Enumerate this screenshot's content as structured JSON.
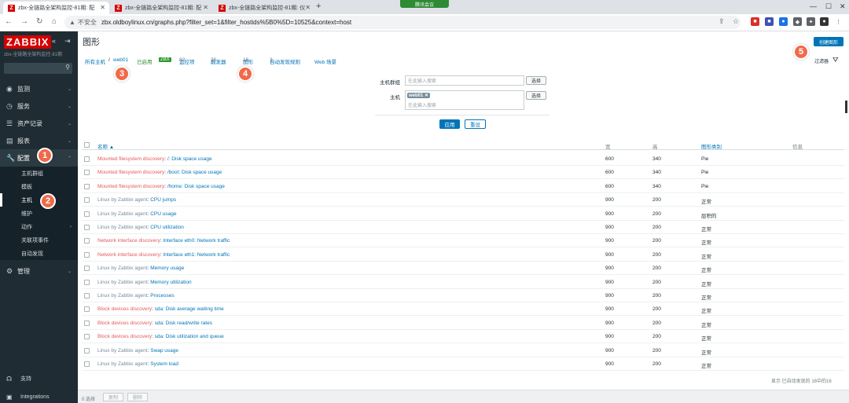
{
  "browser": {
    "tabs": [
      {
        "title": "zbx-全链路全架构监控-81期: 配",
        "active": true
      },
      {
        "title": "zbx-全链路全架构监控-81期: 配",
        "active": false
      },
      {
        "title": "zbx-全链路全架构监控-81期: 仪",
        "active": false
      }
    ],
    "meeting_label": "腾讯会议",
    "insecure_label": "不安全",
    "url": "zbx.oldboylinux.cn/graphs.php?filter_set=1&filter_hostids%5B0%5D=10525&context=host"
  },
  "sidebar": {
    "logo": "ZABBIX",
    "subtitle": "zbx-全链路全架构监控-81期",
    "menu": [
      {
        "label": "监测",
        "icon": "eye-icon"
      },
      {
        "label": "服务",
        "icon": "clock-icon"
      },
      {
        "label": "资产记录",
        "icon": "list-icon"
      },
      {
        "label": "报表",
        "icon": "chart-icon"
      },
      {
        "label": "配置",
        "icon": "wrench-icon"
      }
    ],
    "submenu": [
      "主机群组",
      "模板",
      "主机",
      "维护",
      "动作",
      "关联项事件",
      "自动发现"
    ],
    "admin_label": "管理",
    "support_label": "支持",
    "integrations_label": "Integrations"
  },
  "page": {
    "title": "图形",
    "create_button": "创建图形",
    "filter_label": "过滤器"
  },
  "hostnav": {
    "all_hosts": "所有主机",
    "sep": "/",
    "host": "web01",
    "enabled": "已启用",
    "zbx": "ZBX",
    "items_label": "监控项",
    "items_count": "82",
    "triggers_label": "触发器",
    "triggers_count": "36",
    "graphs_label": "图形",
    "graphs_count": "16",
    "discovery_label": "自动发现规则",
    "discovery_count": "3",
    "web_label": "Web 场景"
  },
  "filter": {
    "hostgroup_label": "主机群组",
    "hostgroup_placeholder": "在此输入搜索",
    "host_label": "主机",
    "host_tag": "web01",
    "host_placeholder": "在此输入搜索",
    "select_label": "选择",
    "apply_label": "应用",
    "reset_label": "重设"
  },
  "table": {
    "headers": {
      "name": "名称 ▲",
      "width": "宽",
      "height": "高",
      "graph_type": "图形类别",
      "info": "信息"
    },
    "rows": [
      {
        "prefix": "Mounted filesystem discovery",
        "prefix_style": "red",
        "name": "/: Disk space usage",
        "width": "600",
        "height": "340",
        "type": "Pie"
      },
      {
        "prefix": "Mounted filesystem discovery",
        "prefix_style": "red",
        "name": "/boot: Disk space usage",
        "width": "600",
        "height": "340",
        "type": "Pie"
      },
      {
        "prefix": "Mounted filesystem discovery",
        "prefix_style": "red",
        "name": "/home: Disk space usage",
        "width": "600",
        "height": "340",
        "type": "Pie"
      },
      {
        "prefix": "Linux by Zabbix agent",
        "prefix_style": "grey",
        "name": "CPU jumps",
        "width": "900",
        "height": "200",
        "type": "正常"
      },
      {
        "prefix": "Linux by Zabbix agent",
        "prefix_style": "grey",
        "name": "CPU usage",
        "width": "900",
        "height": "200",
        "type": "层积的"
      },
      {
        "prefix": "Linux by Zabbix agent",
        "prefix_style": "grey",
        "name": "CPU utilization",
        "width": "900",
        "height": "200",
        "type": "正常"
      },
      {
        "prefix": "Network interface discovery",
        "prefix_style": "red",
        "name": "Interface eth0: Network traffic",
        "width": "900",
        "height": "200",
        "type": "正常"
      },
      {
        "prefix": "Network interface discovery",
        "prefix_style": "red",
        "name": "Interface eth1: Network traffic",
        "width": "900",
        "height": "200",
        "type": "正常"
      },
      {
        "prefix": "Linux by Zabbix agent",
        "prefix_style": "grey",
        "name": "Memory usage",
        "width": "900",
        "height": "200",
        "type": "正常"
      },
      {
        "prefix": "Linux by Zabbix agent",
        "prefix_style": "grey",
        "name": "Memory utilization",
        "width": "900",
        "height": "200",
        "type": "正常"
      },
      {
        "prefix": "Linux by Zabbix agent",
        "prefix_style": "grey",
        "name": "Processes",
        "width": "900",
        "height": "200",
        "type": "正常"
      },
      {
        "prefix": "Block devices discovery",
        "prefix_style": "red",
        "name": "sda: Disk average waiting time",
        "width": "900",
        "height": "200",
        "type": "正常"
      },
      {
        "prefix": "Block devices discovery",
        "prefix_style": "red",
        "name": "sda: Disk read/write rates",
        "width": "900",
        "height": "200",
        "type": "正常"
      },
      {
        "prefix": "Block devices discovery",
        "prefix_style": "red",
        "name": "sda: Disk utilization and queue",
        "width": "900",
        "height": "200",
        "type": "正常"
      },
      {
        "prefix": "Linux by Zabbix agent",
        "prefix_style": "grey",
        "name": "Swap usage",
        "width": "900",
        "height": "200",
        "type": "正常"
      },
      {
        "prefix": "Linux by Zabbix agent",
        "prefix_style": "grey",
        "name": "System load",
        "width": "900",
        "height": "200",
        "type": "正常"
      }
    ],
    "footer": "显示 已自动发现的 16中的16"
  },
  "bottombar": {
    "selected": "0 选择",
    "copy": "复制",
    "delete": "删除"
  },
  "callouts": [
    "1",
    "2",
    "3",
    "4",
    "5"
  ]
}
